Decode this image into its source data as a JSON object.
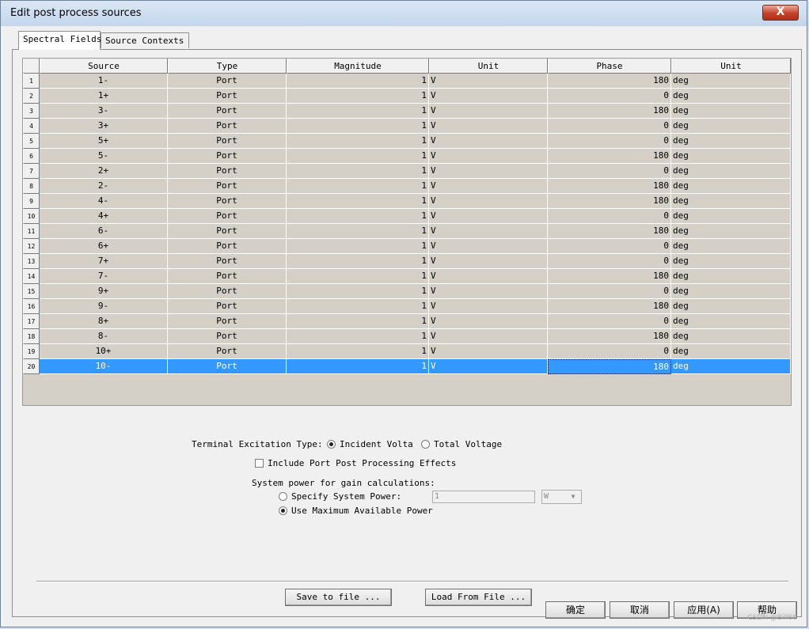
{
  "window": {
    "title": "Edit post process sources",
    "close_label": "X"
  },
  "tabs": [
    {
      "label": "Spectral Fields",
      "active": true
    },
    {
      "label": "Source Contexts",
      "active": false
    }
  ],
  "grid": {
    "columns": [
      "Source",
      "Type",
      "Magnitude",
      "Unit",
      "Phase",
      "Unit"
    ],
    "rows": [
      {
        "num": "1",
        "source": "1-",
        "type": "Port",
        "magnitude": "1",
        "mag_unit": "V",
        "phase": "180",
        "phase_unit": "deg"
      },
      {
        "num": "2",
        "source": "1+",
        "type": "Port",
        "magnitude": "1",
        "mag_unit": "V",
        "phase": "0",
        "phase_unit": "deg"
      },
      {
        "num": "3",
        "source": "3-",
        "type": "Port",
        "magnitude": "1",
        "mag_unit": "V",
        "phase": "180",
        "phase_unit": "deg"
      },
      {
        "num": "4",
        "source": "3+",
        "type": "Port",
        "magnitude": "1",
        "mag_unit": "V",
        "phase": "0",
        "phase_unit": "deg"
      },
      {
        "num": "5",
        "source": "5+",
        "type": "Port",
        "magnitude": "1",
        "mag_unit": "V",
        "phase": "0",
        "phase_unit": "deg"
      },
      {
        "num": "6",
        "source": "5-",
        "type": "Port",
        "magnitude": "1",
        "mag_unit": "V",
        "phase": "180",
        "phase_unit": "deg"
      },
      {
        "num": "7",
        "source": "2+",
        "type": "Port",
        "magnitude": "1",
        "mag_unit": "V",
        "phase": "0",
        "phase_unit": "deg"
      },
      {
        "num": "8",
        "source": "2-",
        "type": "Port",
        "magnitude": "1",
        "mag_unit": "V",
        "phase": "180",
        "phase_unit": "deg"
      },
      {
        "num": "9",
        "source": "4-",
        "type": "Port",
        "magnitude": "1",
        "mag_unit": "V",
        "phase": "180",
        "phase_unit": "deg"
      },
      {
        "num": "10",
        "source": "4+",
        "type": "Port",
        "magnitude": "1",
        "mag_unit": "V",
        "phase": "0",
        "phase_unit": "deg"
      },
      {
        "num": "11",
        "source": "6-",
        "type": "Port",
        "magnitude": "1",
        "mag_unit": "V",
        "phase": "180",
        "phase_unit": "deg"
      },
      {
        "num": "12",
        "source": "6+",
        "type": "Port",
        "magnitude": "1",
        "mag_unit": "V",
        "phase": "0",
        "phase_unit": "deg"
      },
      {
        "num": "13",
        "source": "7+",
        "type": "Port",
        "magnitude": "1",
        "mag_unit": "V",
        "phase": "0",
        "phase_unit": "deg"
      },
      {
        "num": "14",
        "source": "7-",
        "type": "Port",
        "magnitude": "1",
        "mag_unit": "V",
        "phase": "180",
        "phase_unit": "deg"
      },
      {
        "num": "15",
        "source": "9+",
        "type": "Port",
        "magnitude": "1",
        "mag_unit": "V",
        "phase": "0",
        "phase_unit": "deg"
      },
      {
        "num": "16",
        "source": "9-",
        "type": "Port",
        "magnitude": "1",
        "mag_unit": "V",
        "phase": "180",
        "phase_unit": "deg"
      },
      {
        "num": "17",
        "source": "8+",
        "type": "Port",
        "magnitude": "1",
        "mag_unit": "V",
        "phase": "0",
        "phase_unit": "deg"
      },
      {
        "num": "18",
        "source": "8-",
        "type": "Port",
        "magnitude": "1",
        "mag_unit": "V",
        "phase": "180",
        "phase_unit": "deg"
      },
      {
        "num": "19",
        "source": "10+",
        "type": "Port",
        "magnitude": "1",
        "mag_unit": "V",
        "phase": "0",
        "phase_unit": "deg"
      },
      {
        "num": "20",
        "source": "10-",
        "type": "Port",
        "magnitude": "1",
        "mag_unit": "V",
        "phase": "180",
        "phase_unit": "deg",
        "selected": true
      }
    ]
  },
  "excitation": {
    "label": "Terminal Excitation Type:",
    "incident": "Incident Voltag",
    "total": "Total Voltage",
    "selected": "incident"
  },
  "include_port_effects": {
    "label": "Include Port Post Processing Effects",
    "checked": false
  },
  "system_power": {
    "label": "System power for gain calculations:",
    "specify": "Specify System Power:",
    "use_max": "Use Maximum Available Power",
    "selected": "use_max",
    "value": "1",
    "unit": "W"
  },
  "buttons": {
    "save": "Save to file ...",
    "load": "Load From File ...",
    "ok": "确定",
    "cancel": "取消",
    "apply": "应用(A)",
    "help": "帮助"
  },
  "watermark": "CSDN @Bill66",
  "colors": {
    "selection": "#3399ff",
    "grid_bg": "#d4d0c8",
    "dialog_bg": "#f0f0f0"
  }
}
